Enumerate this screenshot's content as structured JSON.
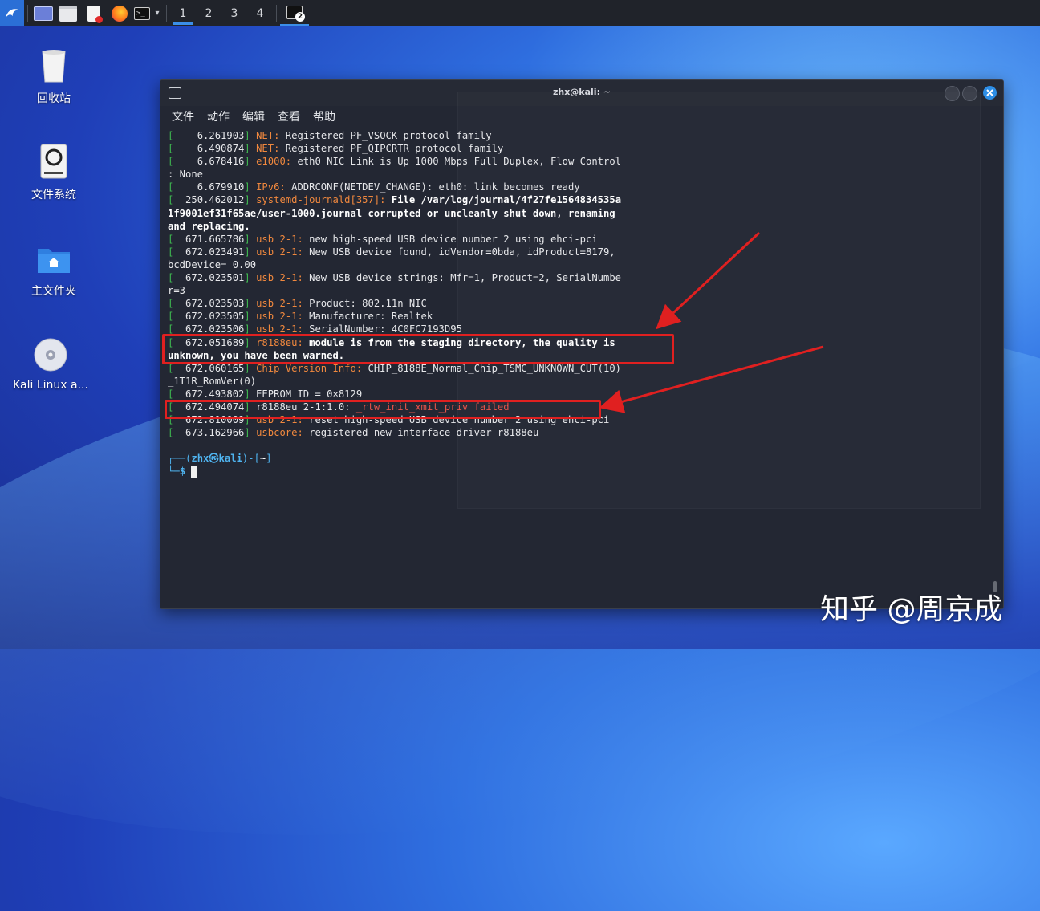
{
  "taskbar": {
    "workspaces": [
      "1",
      "2",
      "3",
      "4"
    ],
    "active_workspace": "1",
    "notif_badge": "2"
  },
  "desktop": {
    "icons": [
      {
        "label": "回收站"
      },
      {
        "label": "文件系统"
      },
      {
        "label": "主文件夹"
      },
      {
        "label": "Kali Linux a..."
      }
    ]
  },
  "terminal": {
    "title": "zhx@kali: ~",
    "menu": [
      "文件",
      "动作",
      "编辑",
      "查看",
      "帮助"
    ],
    "prompt_user": "zhx㉿kali",
    "prompt_dir": "~",
    "prompt_symbol": "$"
  },
  "log": [
    {
      "ts": "    6.261903",
      "src": "NET:",
      "msg": " Registered PF_VSOCK protocol family",
      "style": "o"
    },
    {
      "ts": "    6.490874",
      "src": "NET:",
      "msg": " Registered PF_QIPCRTR protocol family",
      "style": "o"
    },
    {
      "ts": "    6.678416",
      "src": "e1000:",
      "msg": " eth0 NIC Link is Up 1000 Mbps Full Duplex, Flow Control",
      "style": "o"
    },
    {
      "cont": ": None"
    },
    {
      "ts": "    6.679910",
      "src": "IPv6:",
      "msg": " ADDRCONF(NETDEV_CHANGE): eth0: link becomes ready",
      "style": "o"
    },
    {
      "ts": "  250.462012",
      "src": "systemd-journald[357]:",
      "msg": " File /var/log/journal/4f27fe1564834535a",
      "style": "o",
      "bold": true
    },
    {
      "cont": "1f9001ef31f65ae/user-1000.journal corrupted or uncleanly shut down, renaming",
      "bold": true
    },
    {
      "cont": "and replacing.",
      "bold": true
    },
    {
      "ts": "  671.665786",
      "src": "usb 2-1:",
      "msg": " new high-speed USB device number 2 using ehci-pci",
      "style": "o"
    },
    {
      "ts": "  672.023491",
      "src": "usb 2-1:",
      "msg": " New USB device found, idVendor=0bda, idProduct=8179,",
      "style": "o"
    },
    {
      "cont": "bcdDevice= 0.00"
    },
    {
      "ts": "  672.023501",
      "src": "usb 2-1:",
      "msg": " New USB device strings: Mfr=1, Product=2, SerialNumbe",
      "style": "o"
    },
    {
      "cont": "r=3"
    },
    {
      "ts": "  672.023503",
      "src": "usb 2-1:",
      "msg": " Product: 802.11n NIC",
      "style": "o"
    },
    {
      "ts": "  672.023505",
      "src": "usb 2-1:",
      "msg": " Manufacturer: Realtek",
      "style": "o"
    },
    {
      "ts": "  672.023506",
      "src": "usb 2-1:",
      "msg": " SerialNumber: 4C0FC7193D95",
      "style": "o"
    },
    {
      "ts": "  672.051689",
      "src": "r8188eu:",
      "msg": " module is from the staging directory, the quality is",
      "style": "o",
      "bold": true
    },
    {
      "cont": "unknown, you have been warned.",
      "bold": true
    },
    {
      "ts": "  672.060165",
      "src": "Chip Version Info:",
      "msg": " CHIP_8188E_Normal_Chip_TSMC_UNKNOWN_CUT(10)",
      "style": "o"
    },
    {
      "cont": "_1T1R_RomVer(0)"
    },
    {
      "ts": "  672.493802",
      "src": "",
      "msg": "EEPROM ID = 0×8129",
      "style": "o"
    },
    {
      "ts": "  672.494074",
      "src": "r8188eu 2-1:1.0:",
      "msg": " _rtw_init_xmit_priv failed",
      "style": "plain",
      "msgstyle": "r"
    },
    {
      "ts": "  672.810009",
      "src": "usb 2-1:",
      "msg": " reset high-speed USB device number 2 using ehci-pci",
      "style": "o"
    },
    {
      "ts": "  673.162966",
      "src": "usbcore:",
      "msg": " registered new interface driver r8188eu",
      "style": "o"
    }
  ],
  "watermark": "知乎 @周京成",
  "colors": {
    "highlight_box": "#e02020",
    "arrow": "#e02020",
    "accent": "#3b8ee8"
  }
}
